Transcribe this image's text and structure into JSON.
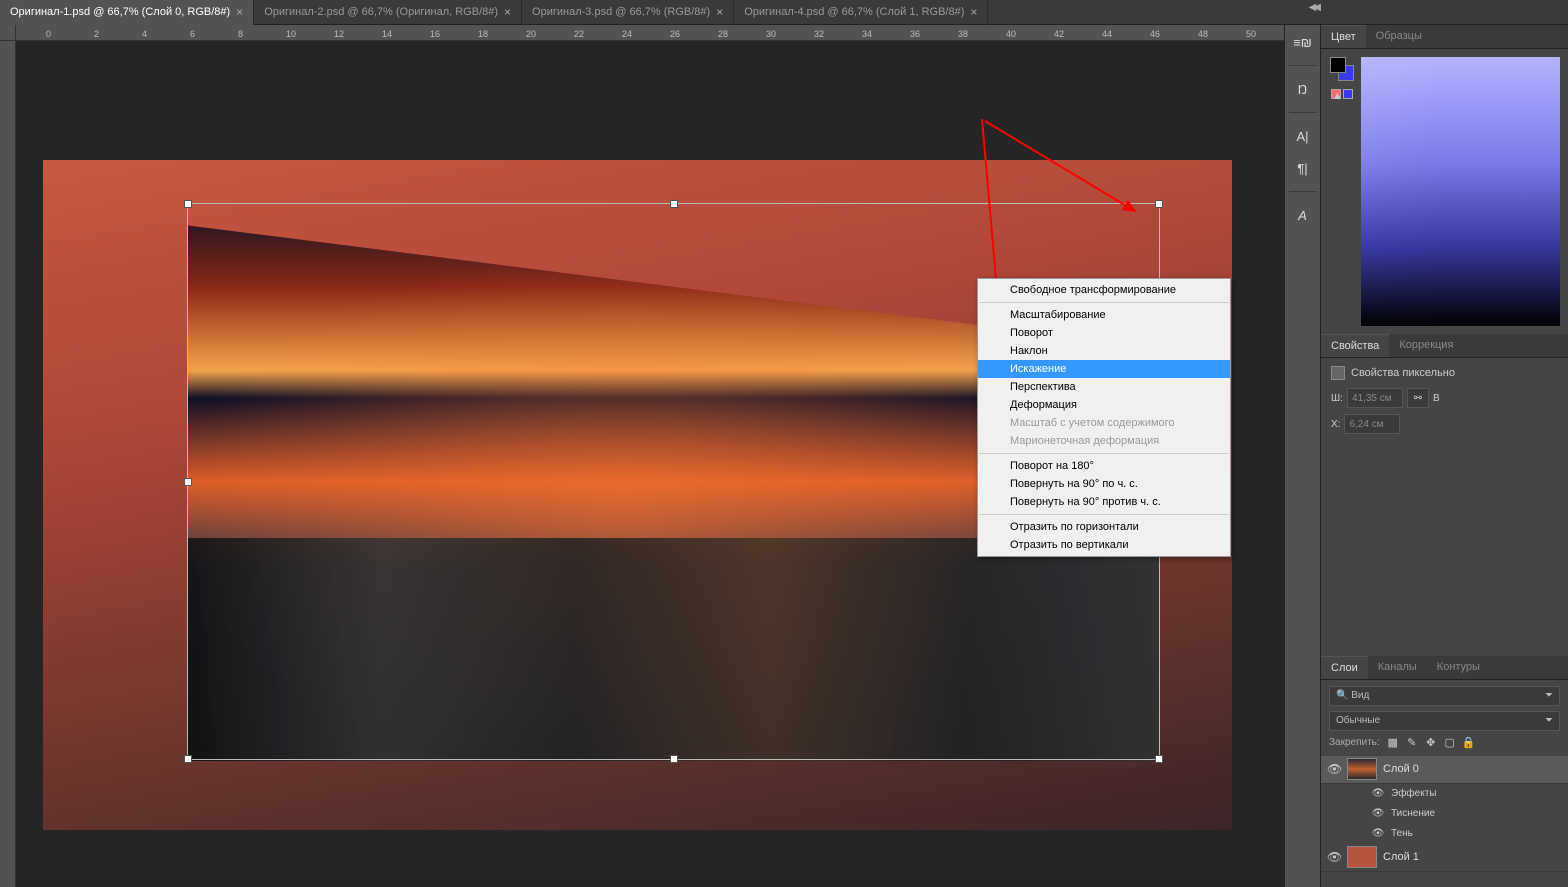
{
  "tabs": [
    {
      "label": "Оригинал-1.psd @ 66,7% (Слой 0, RGB/8#)",
      "active": true
    },
    {
      "label": "Оригинал-2.psd @ 66,7% (Оригинал, RGB/8#)",
      "active": false
    },
    {
      "label": "Оригинал-3.psd @ 66,7% (RGB/8#)",
      "active": false
    },
    {
      "label": "Оригинал-4.psd @ 66,7% (Слой 1, RGB/8#)",
      "active": false
    }
  ],
  "ruler_marks": [
    "0",
    "2",
    "4",
    "6",
    "8",
    "10",
    "12",
    "14",
    "16",
    "18",
    "20",
    "22",
    "24",
    "26",
    "28",
    "30",
    "32",
    "34",
    "36",
    "38",
    "40",
    "42",
    "44",
    "46",
    "48",
    "50"
  ],
  "context_menu": {
    "items": [
      {
        "label": "Свободное трансформирование",
        "type": "item"
      },
      {
        "type": "sep"
      },
      {
        "label": "Масштабирование",
        "type": "item"
      },
      {
        "label": "Поворот",
        "type": "item"
      },
      {
        "label": "Наклон",
        "type": "item"
      },
      {
        "label": "Искажение",
        "type": "item",
        "highlighted": true
      },
      {
        "label": "Перспектива",
        "type": "item"
      },
      {
        "label": "Деформация",
        "type": "item"
      },
      {
        "label": "Масштаб с учетом содержимого",
        "type": "item",
        "disabled": true
      },
      {
        "label": "Марионеточная деформация",
        "type": "item",
        "disabled": true
      },
      {
        "type": "sep"
      },
      {
        "label": "Поворот на 180°",
        "type": "item"
      },
      {
        "label": "Повернуть на 90° по ч. с.",
        "type": "item"
      },
      {
        "label": "Повернуть на 90° против ч. с.",
        "type": "item"
      },
      {
        "type": "sep"
      },
      {
        "label": "Отразить по горизонтали",
        "type": "item"
      },
      {
        "label": "Отразить по вертикали",
        "type": "item"
      }
    ]
  },
  "panels": {
    "color": {
      "tab1": "Цвет",
      "tab2": "Образцы"
    },
    "properties": {
      "tab1": "Свойства",
      "tab2": "Коррекция",
      "title": "Свойства пиксельно",
      "w_label": "Ш:",
      "w_value": "41,35 см",
      "x_label": "X:",
      "x_value": "6,24 см",
      "b_label": "В"
    },
    "layers": {
      "tab1": "Слои",
      "tab2": "Каналы",
      "tab3": "Контуры",
      "filter_label": "Вид",
      "blend_mode": "Обычные",
      "lock_label": "Закрепить:",
      "items": [
        {
          "name": "Слой 0",
          "selected": true,
          "thumb": "img",
          "fx": [
            "Эффекты",
            "Тиснение",
            "Тень"
          ]
        },
        {
          "name": "Слой 1",
          "selected": false,
          "thumb": "solid"
        }
      ]
    }
  }
}
